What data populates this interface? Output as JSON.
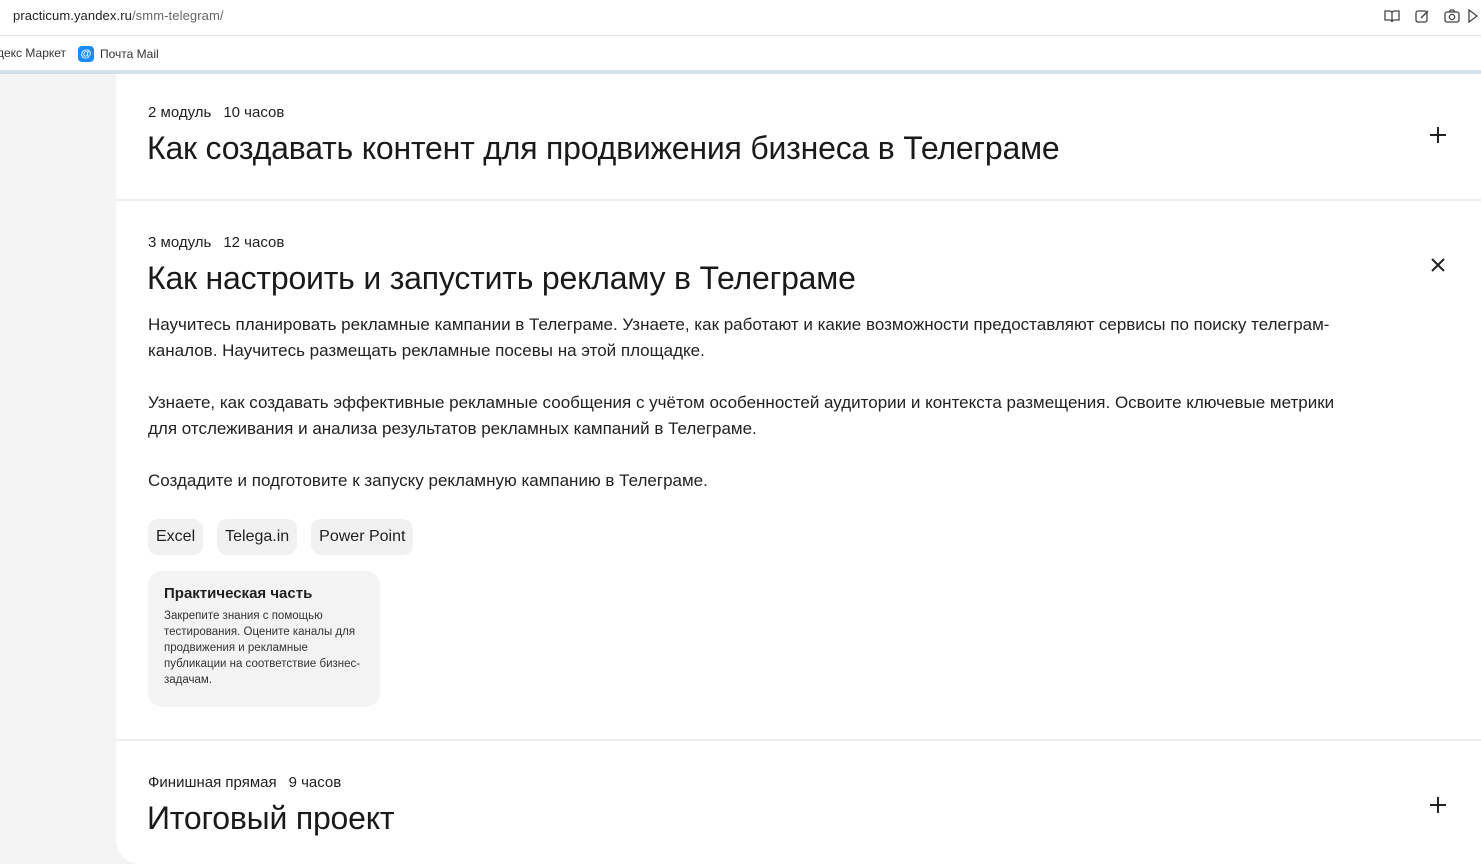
{
  "browser": {
    "url_host": "practicum.yandex.ru",
    "url_path": "/smm-telegram/",
    "icons": [
      "reader-mode-icon",
      "edit-icon",
      "screenshot-icon",
      "more-icon"
    ],
    "bookmarks": [
      {
        "label": "декс Маркет"
      },
      {
        "label": "Почта Mail",
        "icon": "@"
      }
    ]
  },
  "modules": [
    {
      "number": "2 модуль",
      "hours": "10 часов",
      "title": "Как создавать контент для продвижения бизнеса в Телеграме",
      "toggle": "+"
    },
    {
      "number": "3 модуль",
      "hours": "12 часов",
      "title": "Как настроить и запустить рекламу в Телеграме",
      "toggle": "×",
      "description": [
        "Научитесь планировать рекламные кампании в Телеграме. Узнаете, как работают и какие возможности предоставляют сервисы по поиску телеграм-каналов. Научитесь размещать рекламные посевы на этой площадке.",
        "Узнаете, как создавать эффективные рекламные сообщения с учётом особенностей аудитории и контекста размещения. Освоите ключевые метрики для отслеживания и анализа результатов рекламных кампаний в Телеграме.",
        "Создадите и подготовите к запуску рекламную кампанию в Телеграме."
      ],
      "tools": [
        "Excel",
        "Telega.in",
        "Power Point"
      ],
      "practice": {
        "title": "Практическая часть",
        "text": "Закрепите знания с помощью тестирования. Оцените каналы для продвижения и рекламные публикации на соответствие бизнес-задачам."
      }
    },
    {
      "number": "Финишная прямая",
      "hours": "9 часов",
      "title": "Итоговый проект",
      "toggle": "+"
    }
  ]
}
